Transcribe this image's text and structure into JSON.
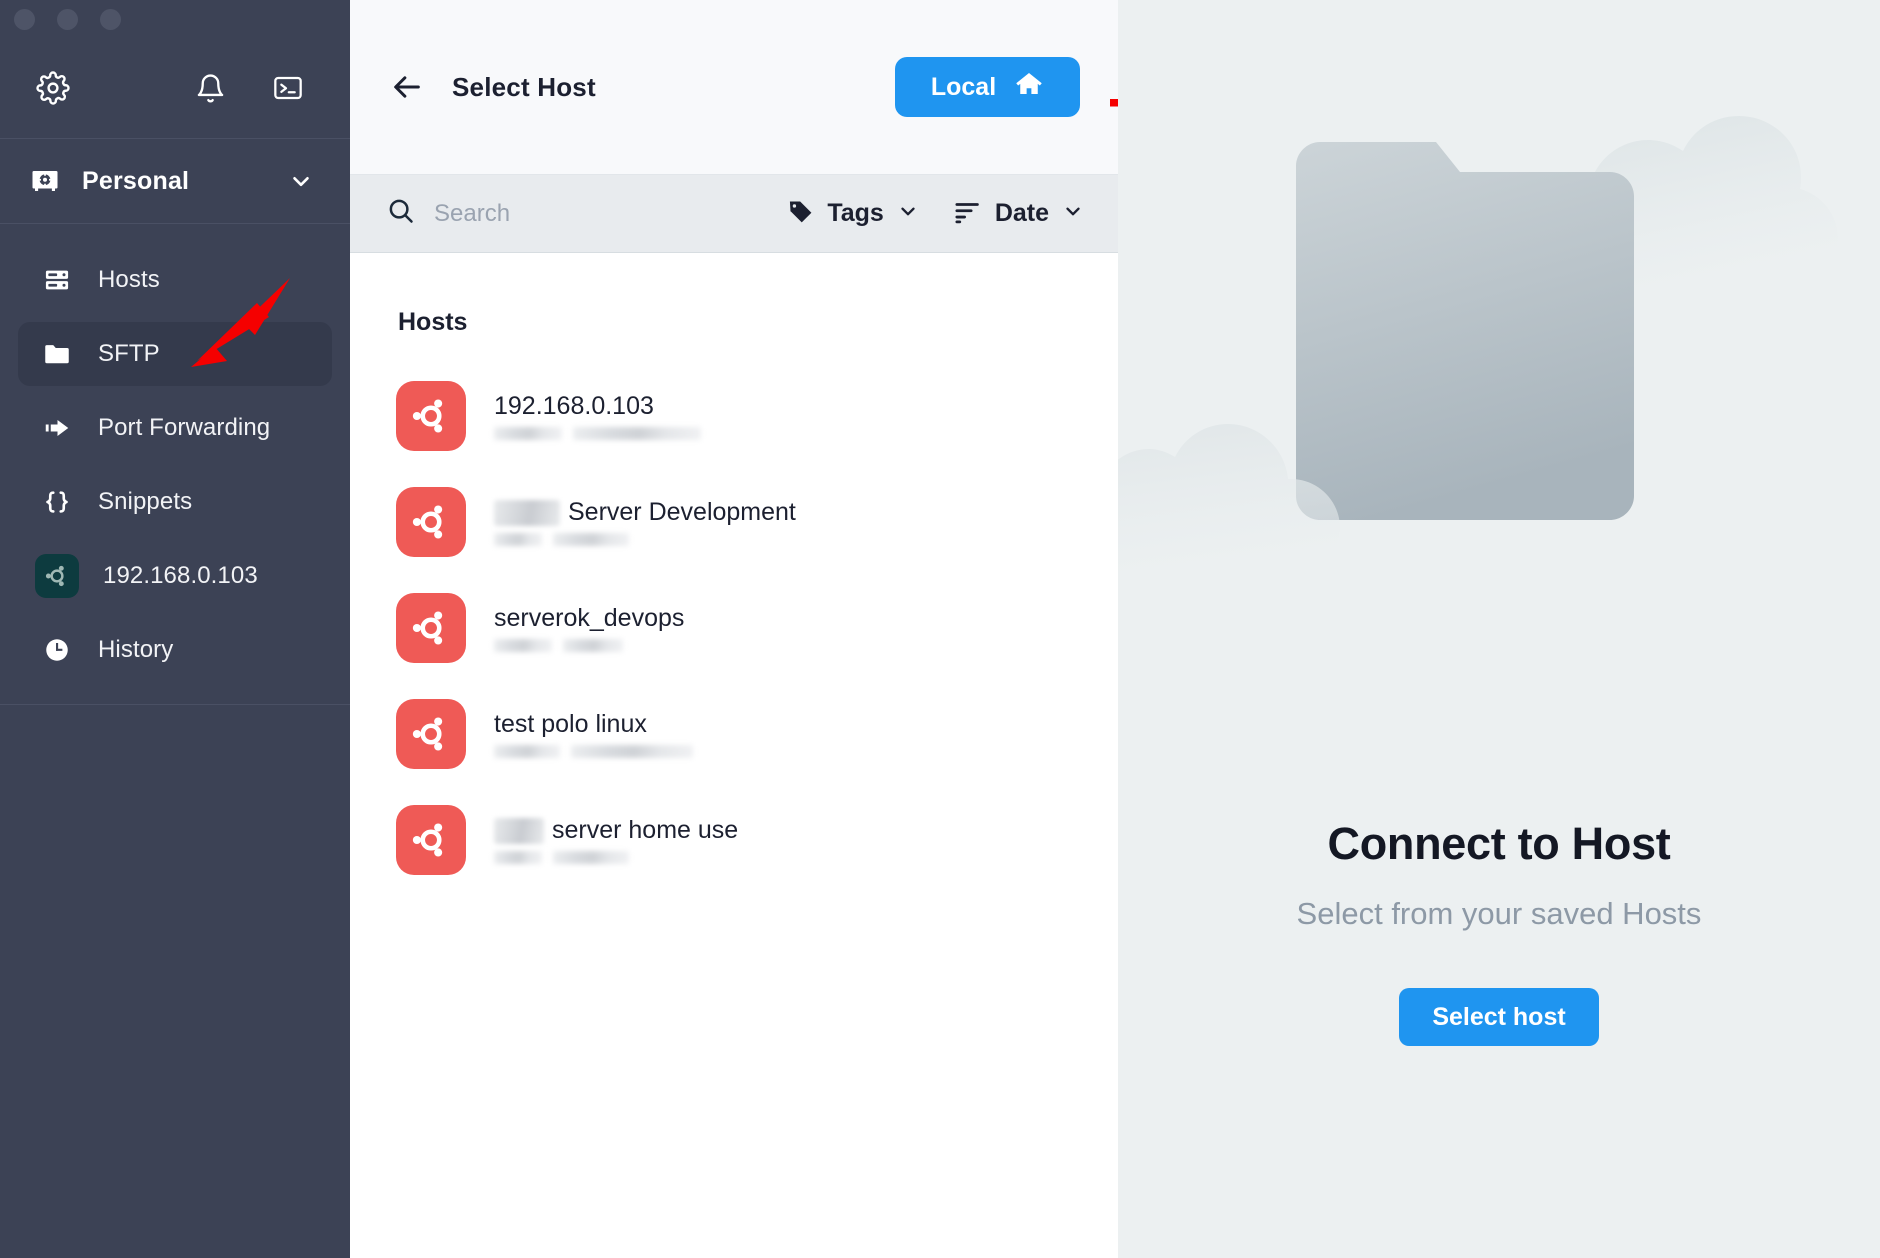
{
  "window": {
    "traffic_lights": [
      "close",
      "minimize",
      "zoom"
    ]
  },
  "sidebar": {
    "tools": [
      {
        "name": "settings-icon",
        "label": "Settings"
      },
      {
        "name": "bell-icon",
        "label": "Notifications"
      },
      {
        "name": "terminal-icon",
        "label": "Terminal"
      }
    ],
    "workspace": {
      "icon": "vault-icon",
      "name": "Personal",
      "chevron": "chevron-down-icon"
    },
    "items": [
      {
        "label": "Hosts",
        "icon": "server-icon",
        "active": false
      },
      {
        "label": "SFTP",
        "icon": "folder-icon",
        "active": true
      },
      {
        "label": "Port Forwarding",
        "icon": "port-forward-icon",
        "active": false
      },
      {
        "label": "Snippets",
        "icon": "braces-icon",
        "active": false
      },
      {
        "label": "192.168.0.103",
        "icon": "ubuntu-icon",
        "active": false
      },
      {
        "label": "History",
        "icon": "clock-icon",
        "active": false
      }
    ]
  },
  "middle": {
    "back_icon": "arrow-left-icon",
    "title": "Select Host",
    "local_button": {
      "label": "Local",
      "icon": "home-icon"
    },
    "search": {
      "placeholder": "Search",
      "value": "",
      "icon": "search-icon"
    },
    "tags_filter": {
      "label": "Tags",
      "icon": "tag-icon",
      "chevron": "chevron-down-icon"
    },
    "sort_filter": {
      "label": "Date",
      "icon": "sort-icon",
      "chevron": "chevron-down-icon"
    },
    "section_title": "Hosts",
    "hosts": [
      {
        "name": "192.168.0.103",
        "redacted_prefix": false,
        "icon": "ubuntu-icon"
      },
      {
        "name": "Server Development",
        "redacted_prefix": true,
        "icon": "ubuntu-icon"
      },
      {
        "name": "serverok_devops",
        "redacted_prefix": false,
        "icon": "ubuntu-icon"
      },
      {
        "name": "test polo linux",
        "redacted_prefix": false,
        "icon": "ubuntu-icon"
      },
      {
        "name": "server home use",
        "redacted_prefix": true,
        "icon": "ubuntu-icon"
      }
    ]
  },
  "right_panel": {
    "illustration": "folder-in-clouds-illustration",
    "title": "Connect to Host",
    "subtitle": "Select from your saved Hosts",
    "button_label": "Select host"
  },
  "annotations": [
    {
      "name": "arrow-to-local-button",
      "color": "#f50000"
    },
    {
      "name": "arrow-to-sftp-item",
      "color": "#f50000"
    },
    {
      "name": "arrow-to-select-host-button",
      "color": "#f50000"
    }
  ],
  "colors": {
    "sidebar_bg": "#3c4255",
    "sidebar_active": "#343a4c",
    "accent_blue": "#1f95f0",
    "host_avatar": "#ef5a56",
    "right_panel_bg": "#ecf0f1",
    "annotation_red": "#f50000"
  }
}
